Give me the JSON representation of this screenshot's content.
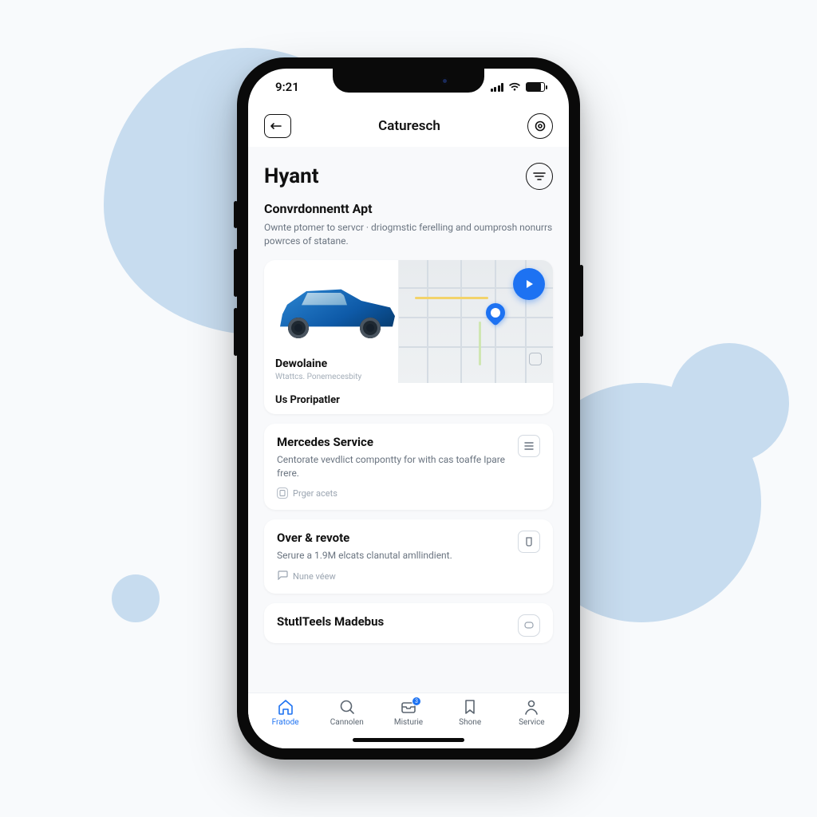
{
  "status": {
    "time": "9:21"
  },
  "nav": {
    "title": "Caturesch"
  },
  "header": {
    "title": "Hyant"
  },
  "section": {
    "title": "Convrdonnentt Apt",
    "desc": "Ownte ptomer to servcr · driogmstic ferelling and oumprosh nonurrs powrces of statane."
  },
  "vehicle": {
    "name": "Dewolaine",
    "sub": "Wtattcs. Ponemecesbity",
    "footer": "Us Proripatler"
  },
  "services": [
    {
      "title": "Mercedes Service",
      "desc": "Centorate vevdlict compontty for with cas toaffe Ipare frere.",
      "meta_label": "Prger acets"
    },
    {
      "title": "Over & revote",
      "desc": "Serure a 1.9M elcats clanutal amllindient.",
      "meta_label": "Nune véew"
    },
    {
      "title": "StutlTeels Madebus",
      "desc": ""
    }
  ],
  "tabs": [
    {
      "label": "Fratode"
    },
    {
      "label": "Cannolen"
    },
    {
      "label": "Misturie",
      "badge": "3"
    },
    {
      "label": "Shone"
    },
    {
      "label": "Service"
    }
  ],
  "colors": {
    "accent": "#1d72f2",
    "blob": "#c7dcef"
  }
}
